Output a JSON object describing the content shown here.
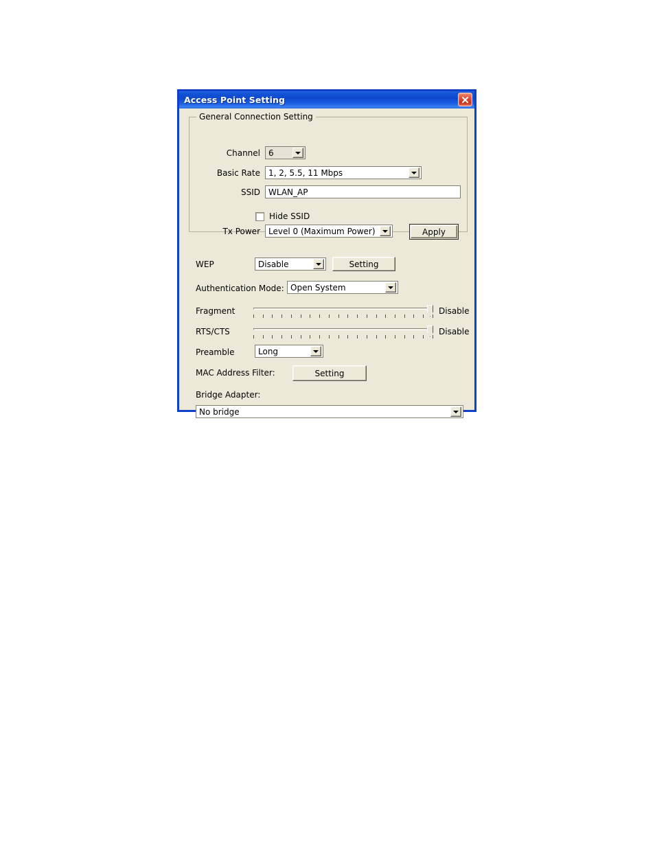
{
  "window": {
    "title": "Access Point Setting",
    "close_icon": "close-icon"
  },
  "group": {
    "legend": "General Connection Setting",
    "channel": {
      "label": "Channel",
      "value": "6"
    },
    "basic_rate": {
      "label": "Basic Rate",
      "value": "1, 2, 5.5, 11 Mbps"
    },
    "ssid": {
      "label": "SSID",
      "value": "WLAN_AP"
    },
    "hide_ssid": {
      "label": "Hide SSID",
      "checked": false
    },
    "tx_power": {
      "label": "Tx Power",
      "value": "Level 0 (Maximum Power)"
    },
    "apply_button": "Apply"
  },
  "advanced": {
    "wep": {
      "label": "WEP",
      "value": "Disable",
      "setting_button": "Setting"
    },
    "auth_mode": {
      "label": "Authentication Mode:",
      "value": "Open System"
    },
    "fragment": {
      "label": "Fragment",
      "value": "Disable",
      "position_percent": 100,
      "tick_count": 20
    },
    "rts_cts": {
      "label": "RTS/CTS",
      "value": "Disable",
      "position_percent": 100,
      "tick_count": 20
    },
    "preamble": {
      "label": "Preamble",
      "value": "Long"
    },
    "mac_filter": {
      "label": "MAC Address Filter:",
      "setting_button": "Setting"
    },
    "bridge_adapter": {
      "label": "Bridge Adapter:",
      "value": "No bridge"
    }
  },
  "colors": {
    "title_bar": "#1456d8",
    "dialog_face": "#ece9d8",
    "frame": "#1040c8",
    "close_button": "#c9301a"
  }
}
